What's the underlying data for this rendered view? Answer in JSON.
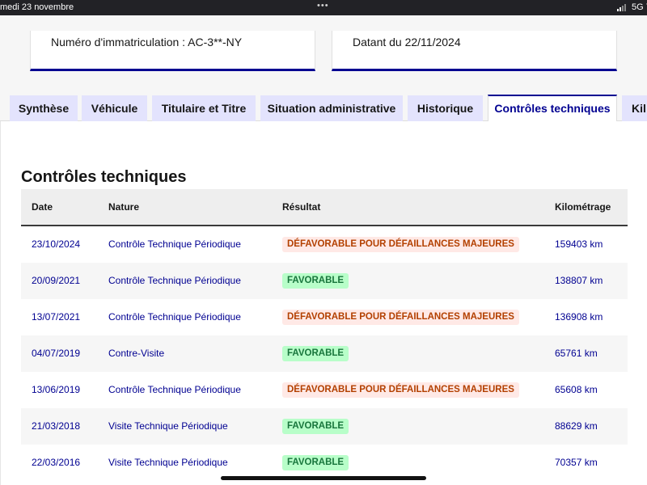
{
  "statusbar": {
    "date": "medi 23 novembre",
    "dots": "•••",
    "network": "5G 7"
  },
  "cards": {
    "registration": "Numéro d'immatriculation : AC-3**-NY",
    "date": "Datant du 22/11/2024"
  },
  "tabs": [
    {
      "label": "Synthèse"
    },
    {
      "label": "Véhicule"
    },
    {
      "label": "Titulaire et Titre"
    },
    {
      "label": "Situation administrative"
    },
    {
      "label": "Historique"
    },
    {
      "label": "Contrôles techniques"
    },
    {
      "label": "Kil"
    }
  ],
  "active_tab_index": 5,
  "section": {
    "title": "Contrôles techniques"
  },
  "table": {
    "headers": {
      "date": "Date",
      "nature": "Nature",
      "result": "Résultat",
      "mileage": "Kilométrage"
    },
    "rows": [
      {
        "date": "23/10/2024",
        "nature": "Contrôle Technique Périodique",
        "result": "DÉFAVORABLE POUR DÉFAILLANCES MAJEURES",
        "status": "bad",
        "mileage": "159403 km"
      },
      {
        "date": "20/09/2021",
        "nature": "Contrôle Technique Périodique",
        "result": "FAVORABLE",
        "status": "good",
        "mileage": "138807 km"
      },
      {
        "date": "13/07/2021",
        "nature": "Contrôle Technique Périodique",
        "result": "DÉFAVORABLE POUR DÉFAILLANCES MAJEURES",
        "status": "bad",
        "mileage": "136908 km"
      },
      {
        "date": "04/07/2019",
        "nature": "Contre-Visite",
        "result": "FAVORABLE",
        "status": "good",
        "mileage": "65761 km"
      },
      {
        "date": "13/06/2019",
        "nature": "Contrôle Technique Périodique",
        "result": "DÉFAVORABLE POUR DÉFAILLANCES MAJEURES",
        "status": "bad",
        "mileage": "65608 km"
      },
      {
        "date": "21/03/2018",
        "nature": "Visite Technique Périodique",
        "result": "FAVORABLE",
        "status": "good",
        "mileage": "88629 km"
      },
      {
        "date": "22/03/2016",
        "nature": "Visite Technique Périodique",
        "result": "FAVORABLE",
        "status": "good",
        "mileage": "70357 km"
      }
    ]
  },
  "colors": {
    "primary": "#000091",
    "tab_bg": "#e3e3fd",
    "bad_text": "#b34000",
    "bad_bg": "#ffe9e6",
    "good_text": "#18753c",
    "good_bg": "#b8fec9"
  }
}
